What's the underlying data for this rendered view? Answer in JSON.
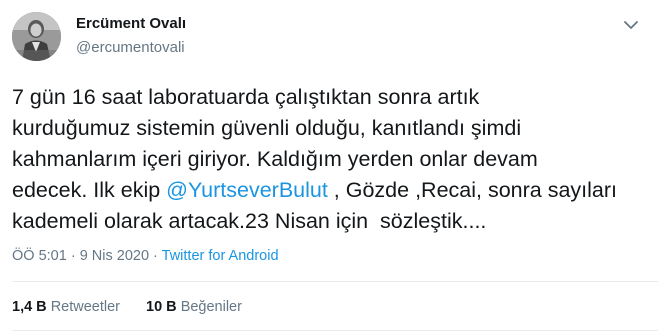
{
  "author": {
    "display_name": "Ercüment Ovalı",
    "handle": "@ercumentovali"
  },
  "icons": {
    "avatar": "profile-photo",
    "menu": "chevron-down-icon"
  },
  "tweet": {
    "line1": "7 gün 16 saat laboratuarda çalıştıktan sonra artık",
    "line2": "kurduğumuz sistemin güvenli olduğu, kanıtlandı şimdi",
    "line3": "kahmanlarım içeri giriyor. Kaldığım yerden onlar devam",
    "line4_before": "edecek. Ilk ekip ",
    "mention": "@YurtseverBulut",
    "line4_after": " , Gözde ,Recai, sonra sayıları",
    "line5": "kademeli olarak artacak.23 Nisan için  sözleştik...."
  },
  "meta": {
    "time": "ÖÖ 5:01",
    "separator1": " · ",
    "date": "9 Nis 2020",
    "separator2": " · ",
    "source": "Twitter for Android"
  },
  "stats": {
    "retweets_count": "1,4 B",
    "retweets_label": "Retweetler",
    "likes_count": "10 B",
    "likes_label": "Beğeniler"
  },
  "colors": {
    "link": "#1b95e0",
    "secondary_text": "#657786",
    "primary_text": "#14171a",
    "divider": "#e6ecf0"
  }
}
